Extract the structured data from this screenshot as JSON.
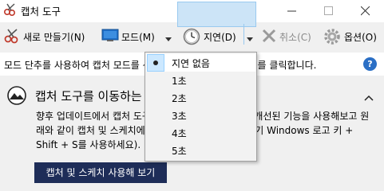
{
  "window": {
    "title": "캡처 도구"
  },
  "toolbar": {
    "new_label": "새로 만들기(N)",
    "mode_label": "모드(M)",
    "delay_label": "지연(D)",
    "cancel_label": "취소(C)",
    "options_label": "옵션(O)"
  },
  "infobar": {
    "text": "모드 단추를 사용하여 캡처 모드를 선택하거나 새로 만들기 단추를 클릭합니다."
  },
  "card": {
    "title": "캡처 도구를 이동하는 중",
    "body": "향후 업데이트에서 캡처 도구가 새 홈으로 이동합니다. 개선된 기능을 사용해보고 원래와 같이 캡처 및 스케치에서 캡처하세요(또는 바로 가기 Windows 로고 키 + Shift + S를 사용하세요).",
    "button_label": "캡처 및 스케치 사용해 보기"
  },
  "delay_menu": {
    "items": [
      {
        "label": "지연 없음"
      },
      {
        "label": "1초"
      },
      {
        "label": "2초"
      },
      {
        "label": "3초"
      },
      {
        "label": "4초"
      },
      {
        "label": "5초"
      }
    ],
    "selected_index": 0
  },
  "colors": {
    "accent": "#2b6fc5",
    "highlight": "#cce4f7",
    "card_button": "#1e2d58"
  }
}
